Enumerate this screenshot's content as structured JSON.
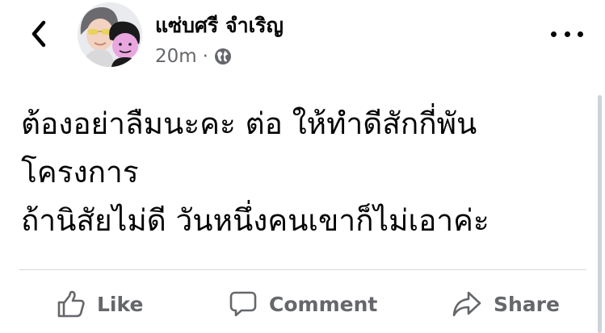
{
  "post": {
    "author": "แซ่บศรี จำเริญ",
    "time": "20m",
    "separator": "·",
    "privacy_icon": "globe-icon",
    "lines": [
      "ต้องอย่าลืมนะคะ ต่อ ให้ทำดีสักกี่พัน",
      "โครงการ",
      "ถ้านิสัยไม่ดี วันหนึ่งคนเขาก็ไม่เอาค่ะ"
    ]
  },
  "header": {
    "back_icon": "chevron-left-icon",
    "more_icon": "more-horizontal-icon"
  },
  "actions": {
    "like_label": "Like",
    "comment_label": "Comment",
    "share_label": "Share"
  },
  "colors": {
    "text": "#050505",
    "secondary": "#65676b",
    "divider": "#d5d7db"
  }
}
